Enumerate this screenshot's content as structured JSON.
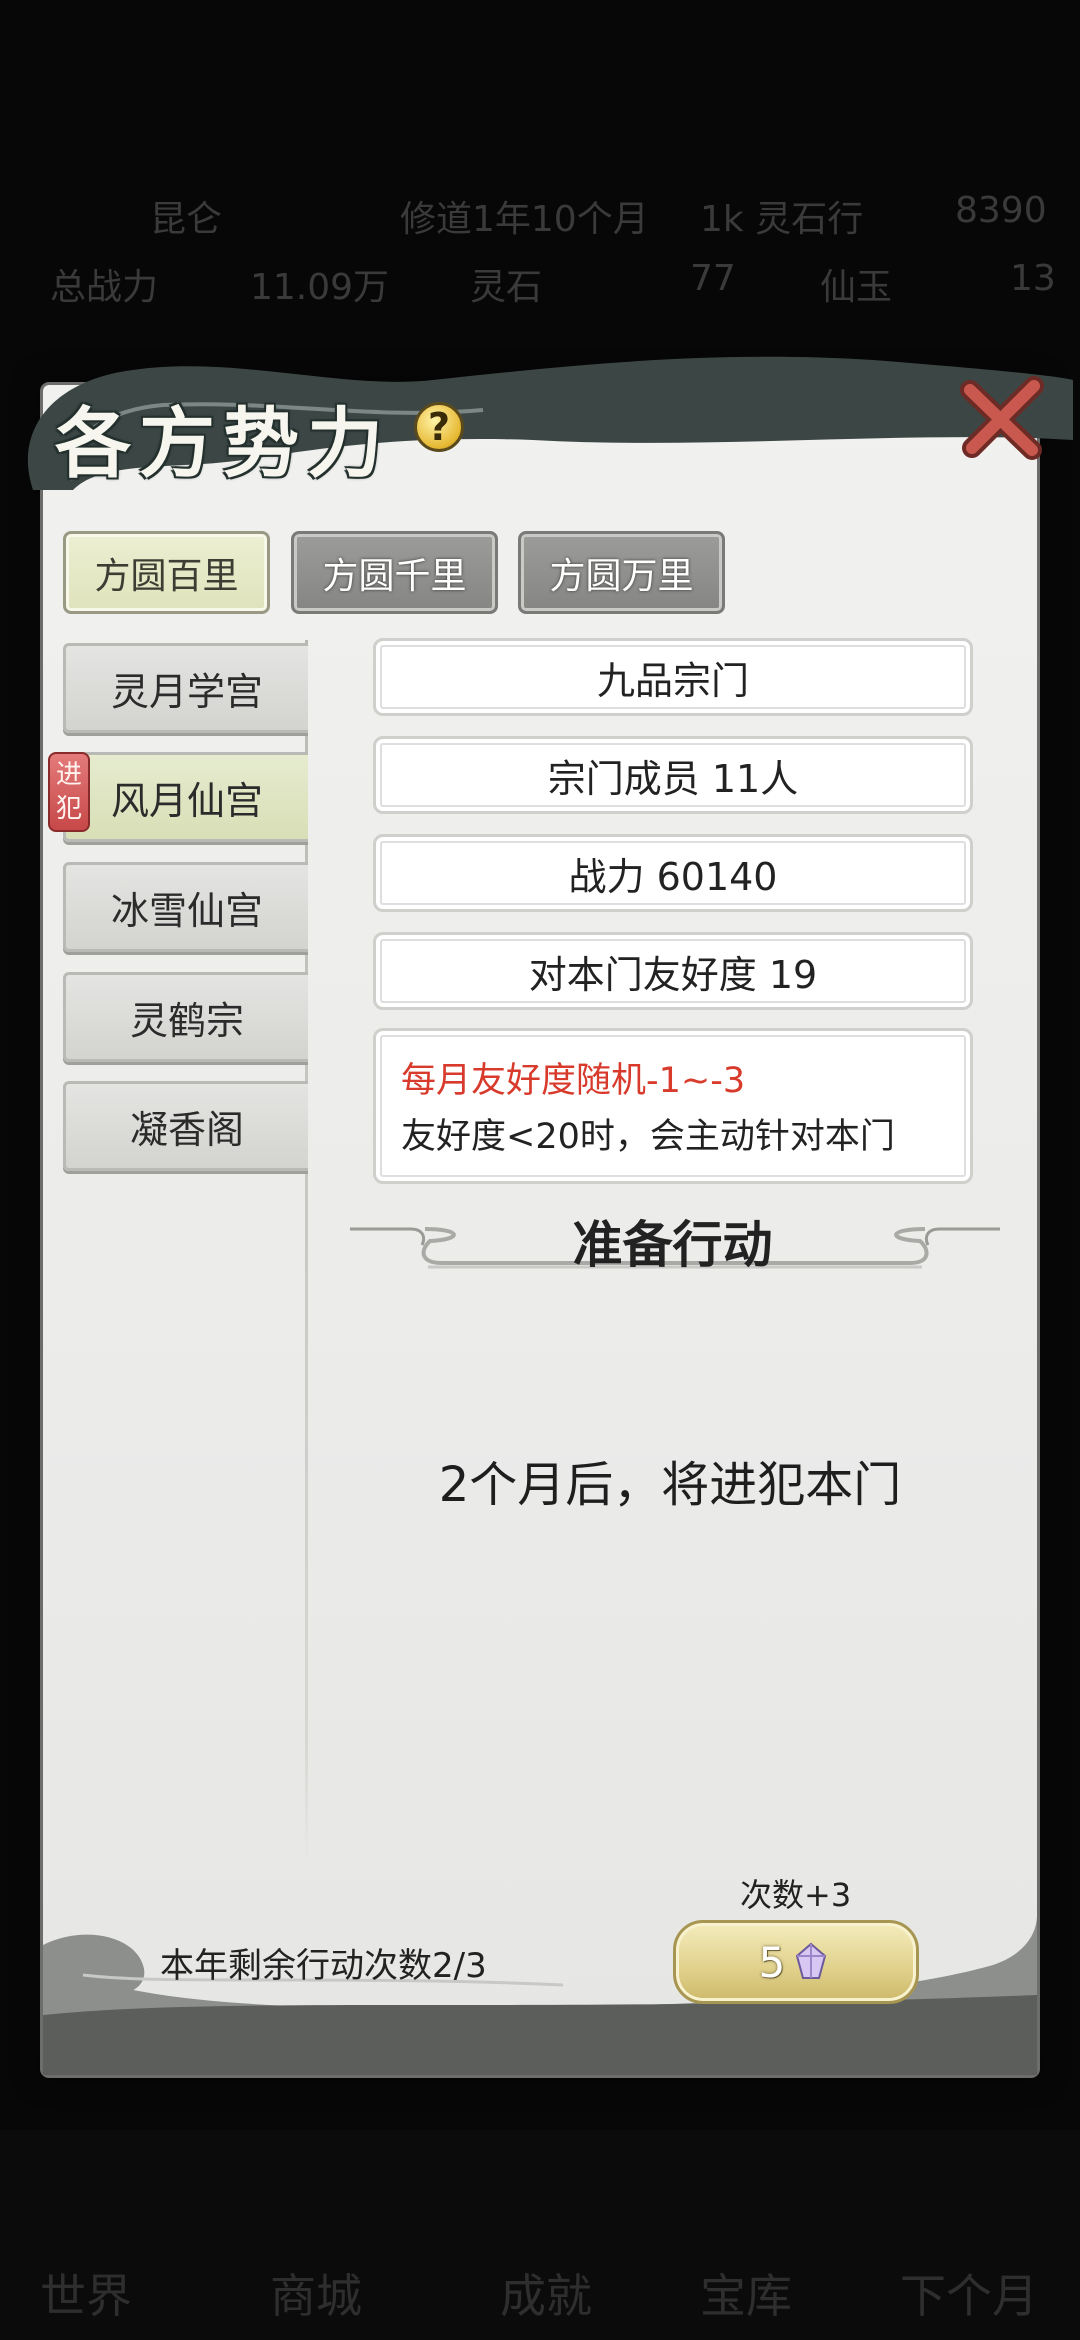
{
  "background": {
    "row1": [
      "昆仑",
      "修道1年10个月",
      "1k 灵石行",
      "8390"
    ],
    "row2": [
      "总战力",
      "11.09万",
      "灵石",
      "77",
      "仙玉",
      "13"
    ],
    "bottom_nav": [
      "世界",
      "商城",
      "成就",
      "宝库",
      "下个月"
    ]
  },
  "dialog": {
    "title": "各方势力",
    "help_icon": "?",
    "tabs": [
      "方圆百里",
      "方圆千里",
      "方圆万里"
    ],
    "sects": [
      "灵月学宫",
      "风月仙宫",
      "冰雪仙宫",
      "灵鹤宗",
      "凝香阁"
    ],
    "invade_badge": "进犯",
    "info": {
      "rank": "九品宗门",
      "members": "宗门成员 11人",
      "power": "战力 60140",
      "friendship": "对本门友好度 19",
      "notice_line1": "每月友好度随机-1~-3",
      "notice_line2": "友好度<20时，会主动针对本门"
    },
    "section_title": "准备行动",
    "action_text": "2个月后，将进犯本门",
    "remaining": "本年剩余行动次数2/3",
    "plus_label": "次数+3",
    "add_button_count": "5",
    "colors": {
      "notice_red": "#d83a2c",
      "tab_active": "#e4e8c6",
      "button_gold": "#e2d38f"
    }
  }
}
